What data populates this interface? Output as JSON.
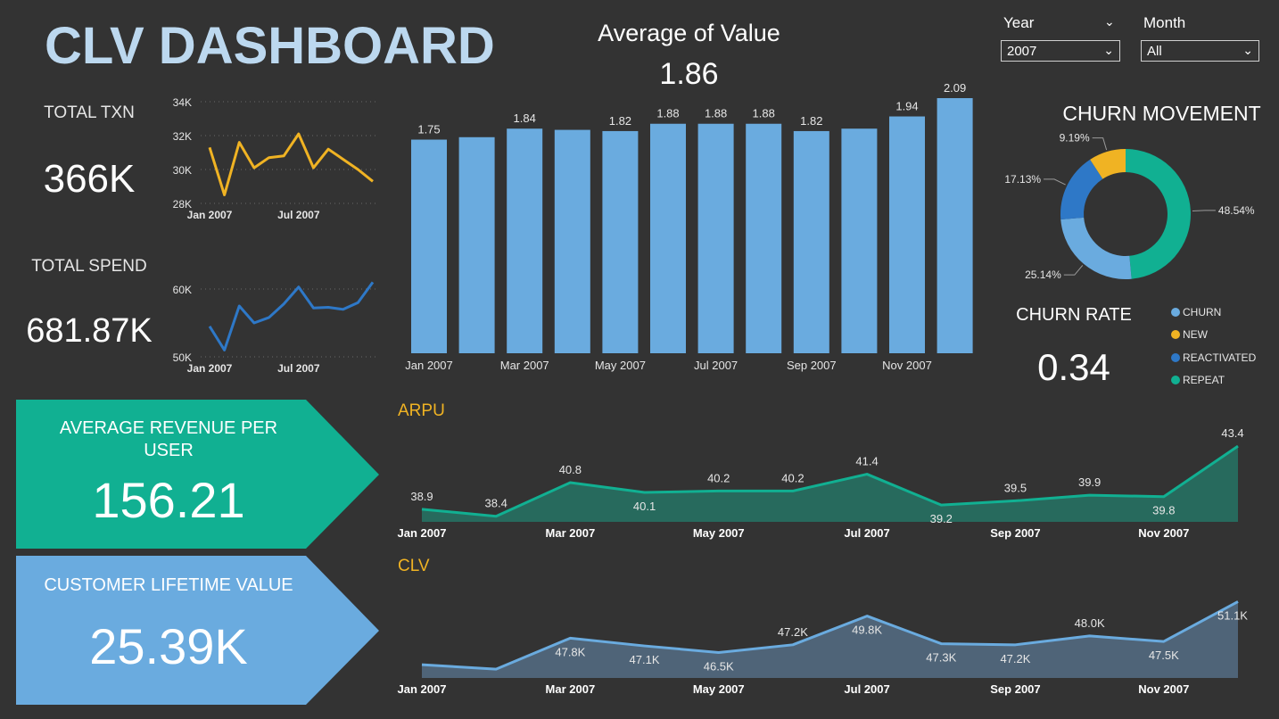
{
  "title": "CLV DASHBOARD",
  "kpis": {
    "total_txn_label": "TOTAL TXN",
    "total_txn_value": "366K",
    "total_spend_label": "TOTAL SPEND",
    "total_spend_value": "681.87K",
    "arpu_label": "AVERAGE REVENUE PER USER",
    "arpu_value": "156.21",
    "clv_label": "CUSTOMER LIFETIME VALUE",
    "clv_value": "25.39K",
    "churn_rate_label": "CHURN RATE",
    "churn_rate_value": "0.34"
  },
  "slicers": {
    "year_label": "Year",
    "year_value": "2007",
    "month_label": "Month",
    "month_value": "All"
  },
  "colors": {
    "txn": "#f0b323",
    "spend": "#2e78c7",
    "bars": "#6aabdf",
    "arpu": "#11b092",
    "clv": "#6aabdf",
    "churn": "#6aabdf",
    "new": "#f0b323",
    "reactivated": "#2e78c7",
    "repeat": "#11b092"
  },
  "chart_data": [
    {
      "type": "line",
      "id": "total_txn",
      "x": [
        "Jan 2007",
        "Feb 2007",
        "Mar 2007",
        "Apr 2007",
        "May 2007",
        "Jun 2007",
        "Jul 2007",
        "Aug 2007",
        "Sep 2007",
        "Oct 2007",
        "Nov 2007",
        "Dec 2007"
      ],
      "values": [
        31300,
        28500,
        31600,
        30100,
        30700,
        30800,
        32100,
        30100,
        31200,
        30600,
        30000,
        29300
      ],
      "yticks": [
        "28K",
        "30K",
        "32K",
        "34K"
      ],
      "ytick_values": [
        28000,
        30000,
        32000,
        34000
      ],
      "ylim": [
        28000,
        34000
      ],
      "xticks": [
        "Jan 2007",
        "Jul 2007"
      ],
      "xtick_index": [
        0,
        6
      ]
    },
    {
      "type": "line",
      "id": "total_spend",
      "x": [
        "Jan 2007",
        "Feb 2007",
        "Mar 2007",
        "Apr 2007",
        "May 2007",
        "Jun 2007",
        "Jul 2007",
        "Aug 2007",
        "Sep 2007",
        "Oct 2007",
        "Nov 2007",
        "Dec 2007"
      ],
      "values": [
        54500,
        51000,
        57500,
        55000,
        55800,
        57800,
        60300,
        57200,
        57300,
        57000,
        58000,
        61000
      ],
      "yticks": [
        "50K",
        "60K"
      ],
      "ytick_values": [
        50000,
        60000
      ],
      "ylim": [
        50000,
        60000
      ],
      "xticks": [
        "Jan 2007",
        "Jul 2007"
      ],
      "xtick_index": [
        0,
        6
      ]
    },
    {
      "type": "bar",
      "id": "average_of_value",
      "title": "Average of Value",
      "subtitle": "1.86",
      "categories": [
        "Jan 2007",
        "Feb 2007",
        "Mar 2007",
        "Apr 2007",
        "May 2007",
        "Jun 2007",
        "Jul 2007",
        "Aug 2007",
        "Sep 2007",
        "Oct 2007",
        "Nov 2007",
        "Dec 2007"
      ],
      "values": [
        1.75,
        1.77,
        1.84,
        1.83,
        1.82,
        1.88,
        1.88,
        1.88,
        1.82,
        1.84,
        1.94,
        2.09
      ],
      "labels": [
        "1.75",
        "",
        "1.84",
        "",
        "1.82",
        "1.88",
        "1.88",
        "1.88",
        "1.82",
        "",
        "1.94",
        "2.09"
      ],
      "xticks": [
        "Jan 2007",
        "Mar 2007",
        "May 2007",
        "Jul 2007",
        "Sep 2007",
        "Nov 2007"
      ],
      "xtick_index": [
        0,
        2,
        4,
        6,
        8,
        10
      ]
    },
    {
      "type": "pie",
      "id": "churn_movement",
      "title": "CHURN MOVEMENT",
      "series": [
        {
          "name": "CHURN",
          "value": 25.14,
          "label": "25.14%"
        },
        {
          "name": "NEW",
          "value": 9.19,
          "label": "9.19%"
        },
        {
          "name": "REACTIVATED",
          "value": 17.13,
          "label": "17.13%"
        },
        {
          "name": "REPEAT",
          "value": 48.54,
          "label": "48.54%"
        }
      ]
    },
    {
      "type": "area",
      "id": "arpu",
      "title": "ARPU",
      "x": [
        "Jan 2007",
        "Feb 2007",
        "Mar 2007",
        "Apr 2007",
        "May 2007",
        "Jun 2007",
        "Jul 2007",
        "Aug 2007",
        "Sep 2007",
        "Oct 2007",
        "Nov 2007",
        "Dec 2007"
      ],
      "values": [
        38.9,
        38.4,
        40.8,
        40.1,
        40.2,
        40.2,
        41.4,
        39.2,
        39.5,
        39.9,
        39.8,
        43.4
      ],
      "labels": [
        "38.9",
        "38.4",
        "40.8",
        "40.1",
        "40.2",
        "40.2",
        "41.4",
        "39.2",
        "39.5",
        "39.9",
        "39.8",
        "43.4"
      ],
      "xticks": [
        "Jan 2007",
        "Mar 2007",
        "May 2007",
        "Jul 2007",
        "Sep 2007",
        "Nov 2007"
      ],
      "xtick_index": [
        0,
        2,
        4,
        6,
        8,
        10
      ]
    },
    {
      "type": "area",
      "id": "clv",
      "title": "CLV",
      "x": [
        "Jan 2007",
        "Feb 2007",
        "Mar 2007",
        "Apr 2007",
        "May 2007",
        "Jun 2007",
        "Jul 2007",
        "Aug 2007",
        "Sep 2007",
        "Oct 2007",
        "Nov 2007",
        "Dec 2007"
      ],
      "values": [
        45.4,
        45.0,
        47.8,
        47.1,
        46.5,
        47.2,
        49.8,
        47.3,
        47.2,
        48.0,
        47.5,
        51.1
      ],
      "labels": [
        "",
        "",
        "47.8K",
        "47.1K",
        "46.5K",
        "47.2K",
        "49.8K",
        "47.3K",
        "47.2K",
        "48.0K",
        "47.5K",
        "51.1K"
      ],
      "xticks": [
        "Jan 2007",
        "Mar 2007",
        "May 2007",
        "Jul 2007",
        "Sep 2007",
        "Nov 2007"
      ],
      "xtick_index": [
        0,
        2,
        4,
        6,
        8,
        10
      ]
    }
  ]
}
